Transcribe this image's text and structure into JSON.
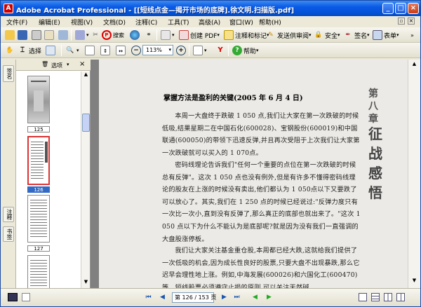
{
  "window": {
    "title": "Adobe Acrobat Professional - [[短线点金—揭开市场的底牌].徐文明.扫描版.pdf]"
  },
  "menu": [
    "文件(F)",
    "编辑(E)",
    "视图(V)",
    "文档(D)",
    "注释(C)",
    "工具(T)",
    "高级(A)",
    "窗口(W)",
    "帮助(H)"
  ],
  "toolbar1": {
    "create_pdf": "创建 PDF",
    "comment_markup": "注释和标记",
    "send_review": "发送供审阅",
    "security": "安全",
    "sign": "签名",
    "forms": "表单",
    "search_label": "搜索"
  },
  "toolbar2": {
    "select": "选择",
    "zoom_value": "113%",
    "help": "帮助"
  },
  "panel": {
    "options": "选项"
  },
  "left_tabs": [
    "签名",
    "注释",
    "书签"
  ],
  "thumbnails": [
    "125",
    "126",
    "127"
  ],
  "document": {
    "heading": "掌握方法是盈利的关键(2005 年 6 月 4 日)",
    "paragraphs": [
      "本周一大盘终于跌破 1 050 点,我们让大家在第一次跌破的时候低吸,结果星期二在中国石化(600028)、宝钢股份(600019)和中国联通(600050)的带领下迅速反弹,并且再次受阻于上次我们让大家第一次跌破就可以买入的 1 070点。",
      "密码线理论告诉我们\"任何一个重要的点位在第一次跌破的时候总有反弹\"。这次 1 050 点也没有例外,但是有许多不懂得密码线理论的股友在上涨的时候没有卖出,他们都认为 1 050点以下又要跌了可以放心了。其实,我们在 1 250 点的时候已经说过:\"反弹力度只有一次比一次小,直到没有反弹了,那么真正的底部也就出来了。\"这次 1 050 点以下为什么不能认为是底部呢?就是因为没有我们一直强调的大盘股涨停板。",
      "我们让大家关注基金重仓股,本周都已经大跌,这就给我们提供了一次低吸的机会,因为成长性良好的股票,只要大盘不出现暴跌,那么它迟早会理性地上涨。例如,中海发展(600026)和六国化工(600470)等。短线股票必须遵守止损的原则,可以关注天然碱"
    ],
    "chapter_number": "第八章",
    "chapter_title": "征战感悟"
  },
  "status": {
    "page_indicator": "第 126 / 153 页"
  }
}
